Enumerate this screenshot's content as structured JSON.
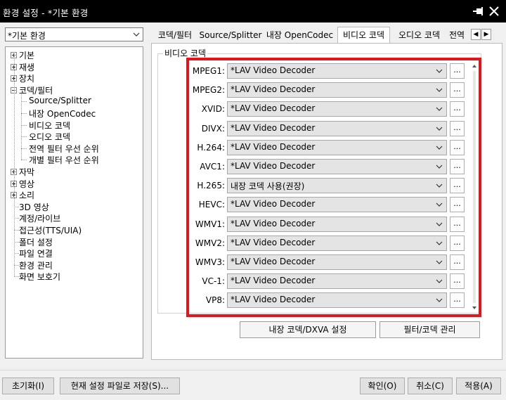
{
  "window": {
    "title": "환경 설정 - *기본 환경",
    "pin_icon": "pin-icon",
    "close_icon": "close-icon"
  },
  "preset": {
    "value": "*기본 환경"
  },
  "tree": {
    "items": [
      {
        "label": "기본",
        "expander": "+"
      },
      {
        "label": "재생",
        "expander": "+"
      },
      {
        "label": "장치",
        "expander": "+"
      },
      {
        "label": "코덱/필터",
        "expander": "-"
      },
      {
        "label": "Source/Splitter"
      },
      {
        "label": "내장 OpenCodec"
      },
      {
        "label": "비디오 코덱"
      },
      {
        "label": "오디오 코덱"
      },
      {
        "label": "전역 필터 우선 순위"
      },
      {
        "label": "개별 필터 우선 순위"
      },
      {
        "label": "자막",
        "expander": "+"
      },
      {
        "label": "영상",
        "expander": "+"
      },
      {
        "label": "소리",
        "expander": "+"
      },
      {
        "label": "3D 영상"
      },
      {
        "label": "계정/라이브"
      },
      {
        "label": "접근성(TTS/UIA)"
      },
      {
        "label": "폴더 설정"
      },
      {
        "label": "파일 연결"
      },
      {
        "label": "환경 관리"
      },
      {
        "label": "화면 보호기"
      }
    ]
  },
  "tabs": {
    "items": [
      "코덱/필터",
      "Source/Splitter",
      "내장 OpenCodec",
      "비디오 코덱",
      "오디오 코덱",
      "전역"
    ],
    "active_index": 3
  },
  "group": {
    "label": "비디오 코덱"
  },
  "codecs": [
    {
      "label": "MPEG1:",
      "value": "*LAV Video Decoder"
    },
    {
      "label": "MPEG2:",
      "value": "*LAV Video Decoder"
    },
    {
      "label": "XVID:",
      "value": "*LAV Video Decoder"
    },
    {
      "label": "DIVX:",
      "value": "*LAV Video Decoder"
    },
    {
      "label": "H.264:",
      "value": "*LAV Video Decoder"
    },
    {
      "label": "AVC1:",
      "value": "*LAV Video Decoder"
    },
    {
      "label": "H.265:",
      "value": "내장 코덱 사용(권장)"
    },
    {
      "label": "HEVC:",
      "value": "*LAV Video Decoder"
    },
    {
      "label": "WMV1:",
      "value": "*LAV Video Decoder"
    },
    {
      "label": "WMV2:",
      "value": "*LAV Video Decoder"
    },
    {
      "label": "WMV3:",
      "value": "*LAV Video Decoder"
    },
    {
      "label": "VC-1:",
      "value": "*LAV Video Decoder"
    },
    {
      "label": "VP8:",
      "value": "*LAV Video Decoder"
    }
  ],
  "more_button_label": "...",
  "actions": {
    "dxva": "내장 코덱/DXVA 설정",
    "filter_manage": "필터/코덱 관리"
  },
  "footer": {
    "reset": "초기화(I)",
    "save_current": "현재 설정 파일로 저장(S)...",
    "ok": "확인(O)",
    "cancel": "취소(C)",
    "apply": "적용(A)"
  },
  "colors": {
    "highlight_border": "#e3141b"
  }
}
